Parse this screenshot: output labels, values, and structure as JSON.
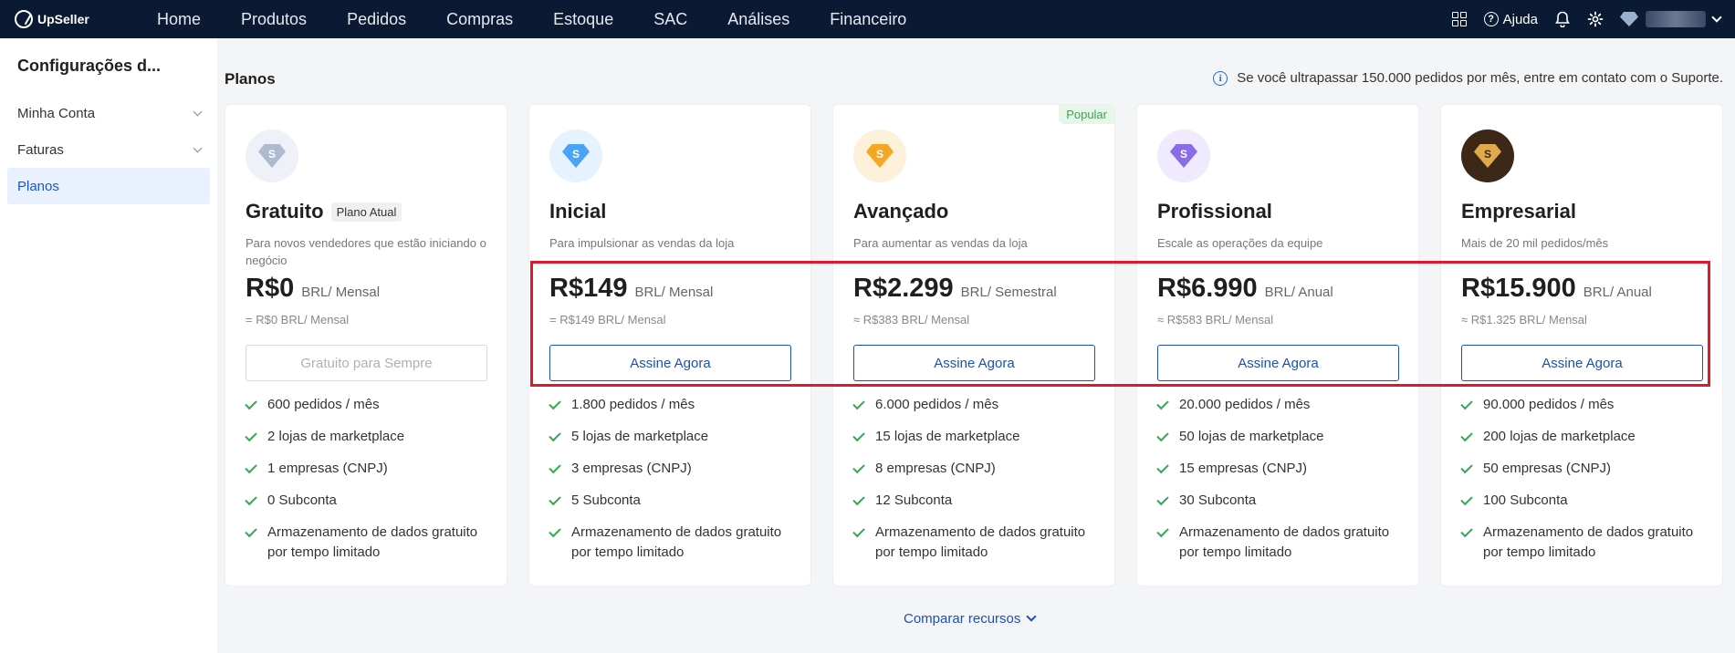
{
  "topnav": {
    "brand": "UpSeller",
    "items": [
      "Home",
      "Produtos",
      "Pedidos",
      "Compras",
      "Estoque",
      "SAC",
      "Análises",
      "Financeiro"
    ],
    "help_label": "Ajuda"
  },
  "sidebar": {
    "title": "Configurações d...",
    "items": [
      {
        "label": "Minha Conta"
      },
      {
        "label": "Faturas"
      },
      {
        "label": "Planos"
      }
    ]
  },
  "main": {
    "title": "Planos",
    "notice": "Se você ultrapassar 150.000 pedidos por mês, entre em contato com o Suporte.",
    "compare_label": "Comparar recursos"
  },
  "plans": [
    {
      "name": "Gratuito",
      "badge": "Plano Atual",
      "desc": "Para novos vendedores que estão iniciando o negócio",
      "price": "R$0",
      "period": "BRL/ Mensal",
      "monthly": "= R$0 BRL/ Mensal",
      "button": "Gratuito para Sempre",
      "icon_color": "#aebad0",
      "features": [
        "600 pedidos / mês",
        "2 lojas de marketplace",
        "1 empresas (CNPJ)",
        "0 Subconta",
        "Armazenamento de dados gratuito por tempo limitado"
      ]
    },
    {
      "name": "Inicial",
      "desc": "Para impulsionar as vendas da loja",
      "price": "R$149",
      "period": "BRL/ Mensal",
      "monthly": "= R$149 BRL/ Mensal",
      "button": "Assine Agora",
      "icon_color": "#4aa4f5",
      "features": [
        "1.800 pedidos / mês",
        "5 lojas de marketplace",
        "3 empresas (CNPJ)",
        "5 Subconta",
        "Armazenamento de dados gratuito por tempo limitado"
      ]
    },
    {
      "name": "Avançado",
      "popular": "Popular",
      "desc": "Para aumentar as vendas da loja",
      "price": "R$2.299",
      "period": "BRL/ Semestral",
      "monthly": "≈ R$383 BRL/ Mensal",
      "button": "Assine Agora",
      "icon_color": "#f5a623",
      "features": [
        "6.000 pedidos / mês",
        "15 lojas de marketplace",
        "8 empresas (CNPJ)",
        "12 Subconta",
        "Armazenamento de dados gratuito por tempo limitado"
      ]
    },
    {
      "name": "Profissional",
      "desc": "Escale as operações da equipe",
      "price": "R$6.990",
      "period": "BRL/ Anual",
      "monthly": "≈ R$583 BRL/ Mensal",
      "button": "Assine Agora",
      "icon_color": "#8a6ce8",
      "features": [
        "20.000 pedidos / mês",
        "50 lojas de marketplace",
        "15 empresas (CNPJ)",
        "30 Subconta",
        "Armazenamento de dados gratuito por tempo limitado"
      ]
    },
    {
      "name": "Empresarial",
      "desc": "Mais de 20 mil pedidos/mês",
      "price": "R$15.900",
      "period": "BRL/ Anual",
      "monthly": "≈ R$1.325 BRL/ Mensal",
      "button": "Assine Agora",
      "icon_color": "#e0a94a",
      "features": [
        "90.000 pedidos / mês",
        "200 lojas de marketplace",
        "50 empresas (CNPJ)",
        "100 Subconta",
        "Armazenamento de dados gratuito por tempo limitado"
      ]
    }
  ]
}
